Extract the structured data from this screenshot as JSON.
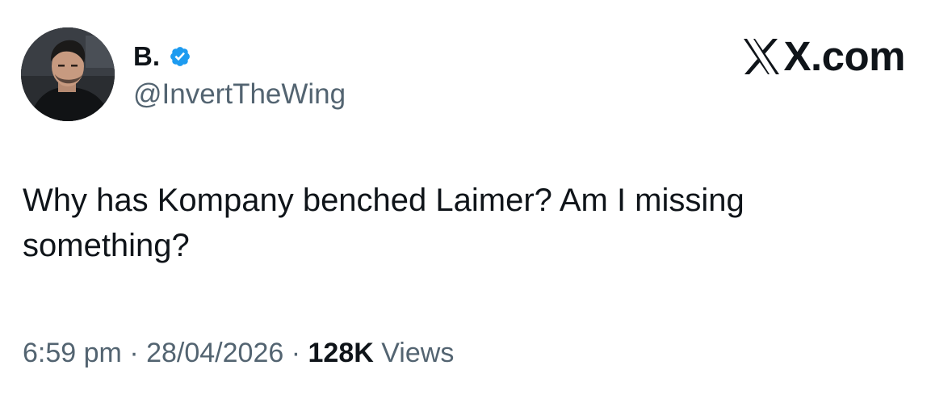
{
  "author": {
    "display_name": "B.",
    "handle": "@InvertTheWing",
    "verified": true,
    "verified_color": "#1d9bf0"
  },
  "brand": {
    "text": "X.com",
    "icon": "x-logo-icon"
  },
  "tweet": {
    "text": "Why has Kompany benched Laimer? Am I missing something?"
  },
  "meta": {
    "time": "6:59 pm",
    "separator": "·",
    "date": "28/04/2026",
    "views_count": "128K",
    "views_label": "Views"
  },
  "colors": {
    "text_primary": "#0f1419",
    "text_secondary": "#536471",
    "background": "#ffffff"
  }
}
